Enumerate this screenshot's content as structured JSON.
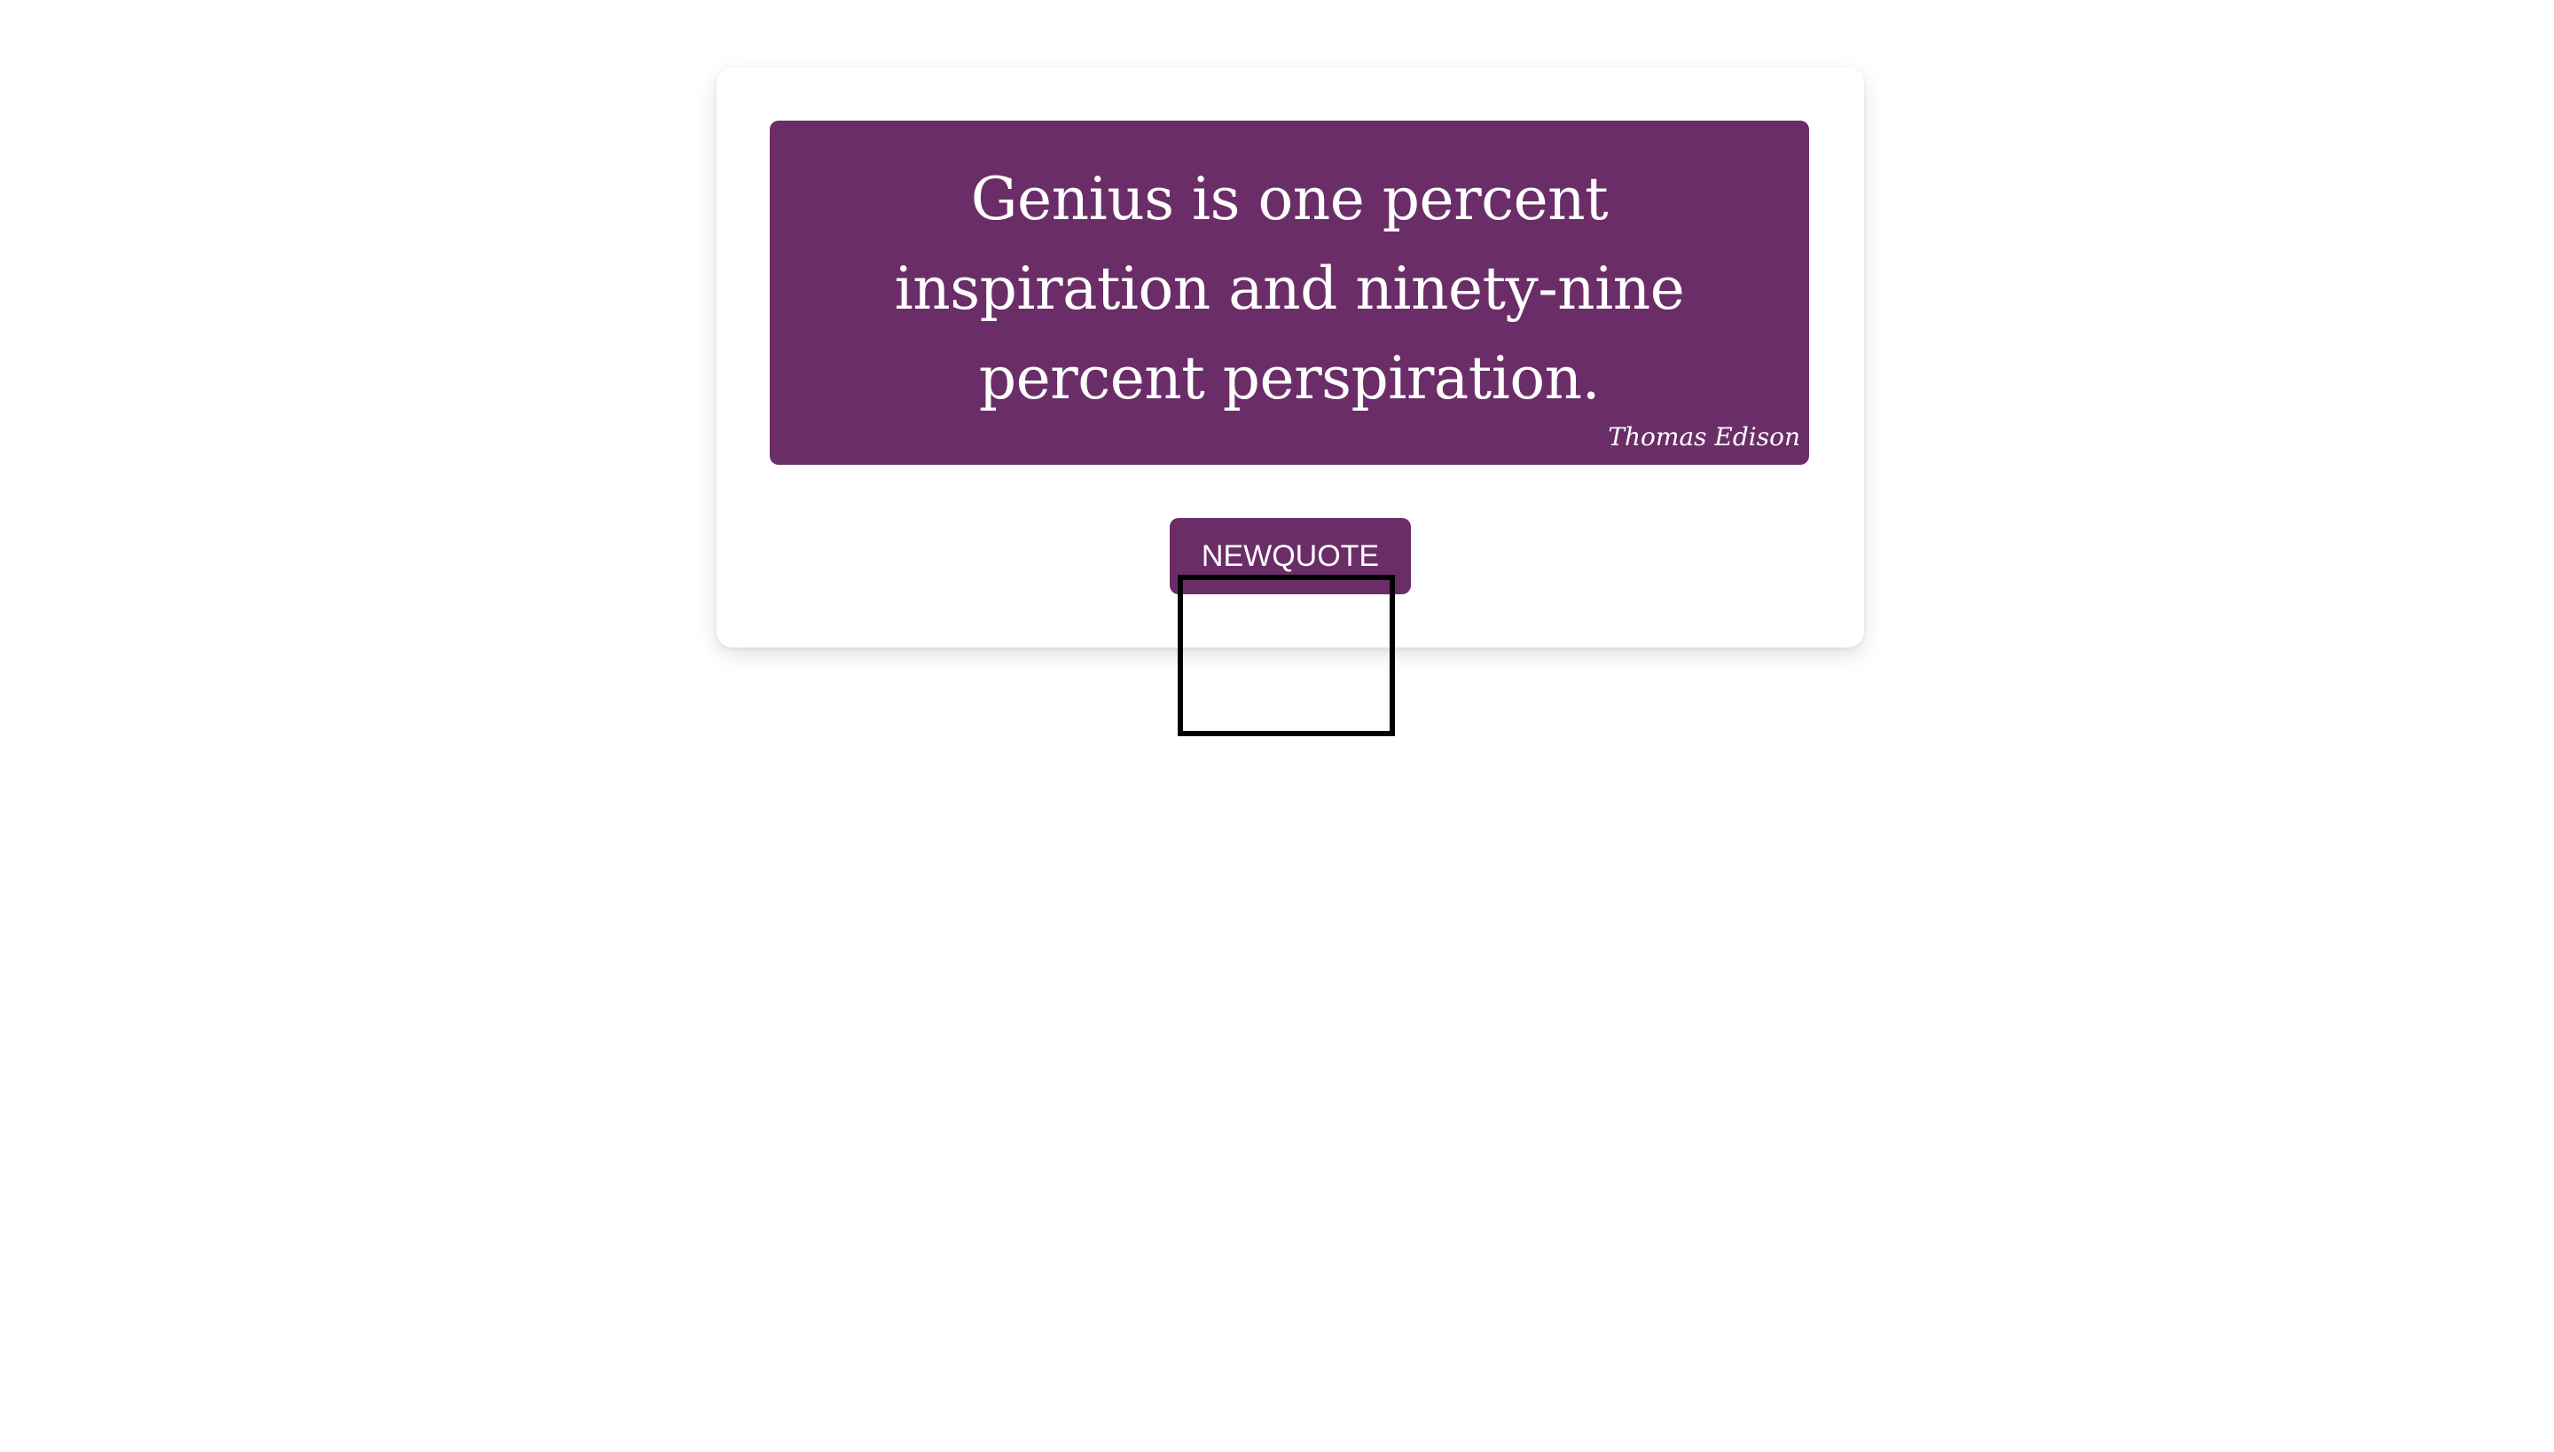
{
  "quote": {
    "text": "Genius is one percent inspiration and ninety-nine percent perspiration.",
    "author": "Thomas Edison"
  },
  "controls": {
    "new_quote_label": "NEWQUOTE"
  },
  "colors": {
    "accent": "#6b2d67",
    "background": "#ffffff",
    "text_on_accent": "#ffffff"
  }
}
